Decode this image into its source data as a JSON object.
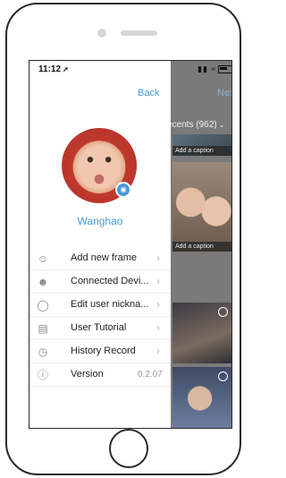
{
  "status_bar": {
    "time": "11:12"
  },
  "background_app": {
    "next_label": "Next",
    "album_label": "ecents (962)",
    "captions": [
      "Add a caption",
      "Add a caption"
    ]
  },
  "drawer": {
    "back_label": "Back",
    "username": "Wanghao",
    "menu": [
      {
        "label": "Add new frame",
        "icon": "add-user-icon"
      },
      {
        "label": "Connected Devi...",
        "icon": "users-icon"
      },
      {
        "label": "Edit user nickna...",
        "icon": "user-icon"
      },
      {
        "label": "User Tutorial",
        "icon": "document-icon"
      },
      {
        "label": "History Record",
        "icon": "clock-icon"
      },
      {
        "label": "Version",
        "icon": "info-icon",
        "value": "0.2.07"
      }
    ]
  },
  "colors": {
    "accent": "#4a9ad8",
    "overlay": "#7a7a7a"
  }
}
